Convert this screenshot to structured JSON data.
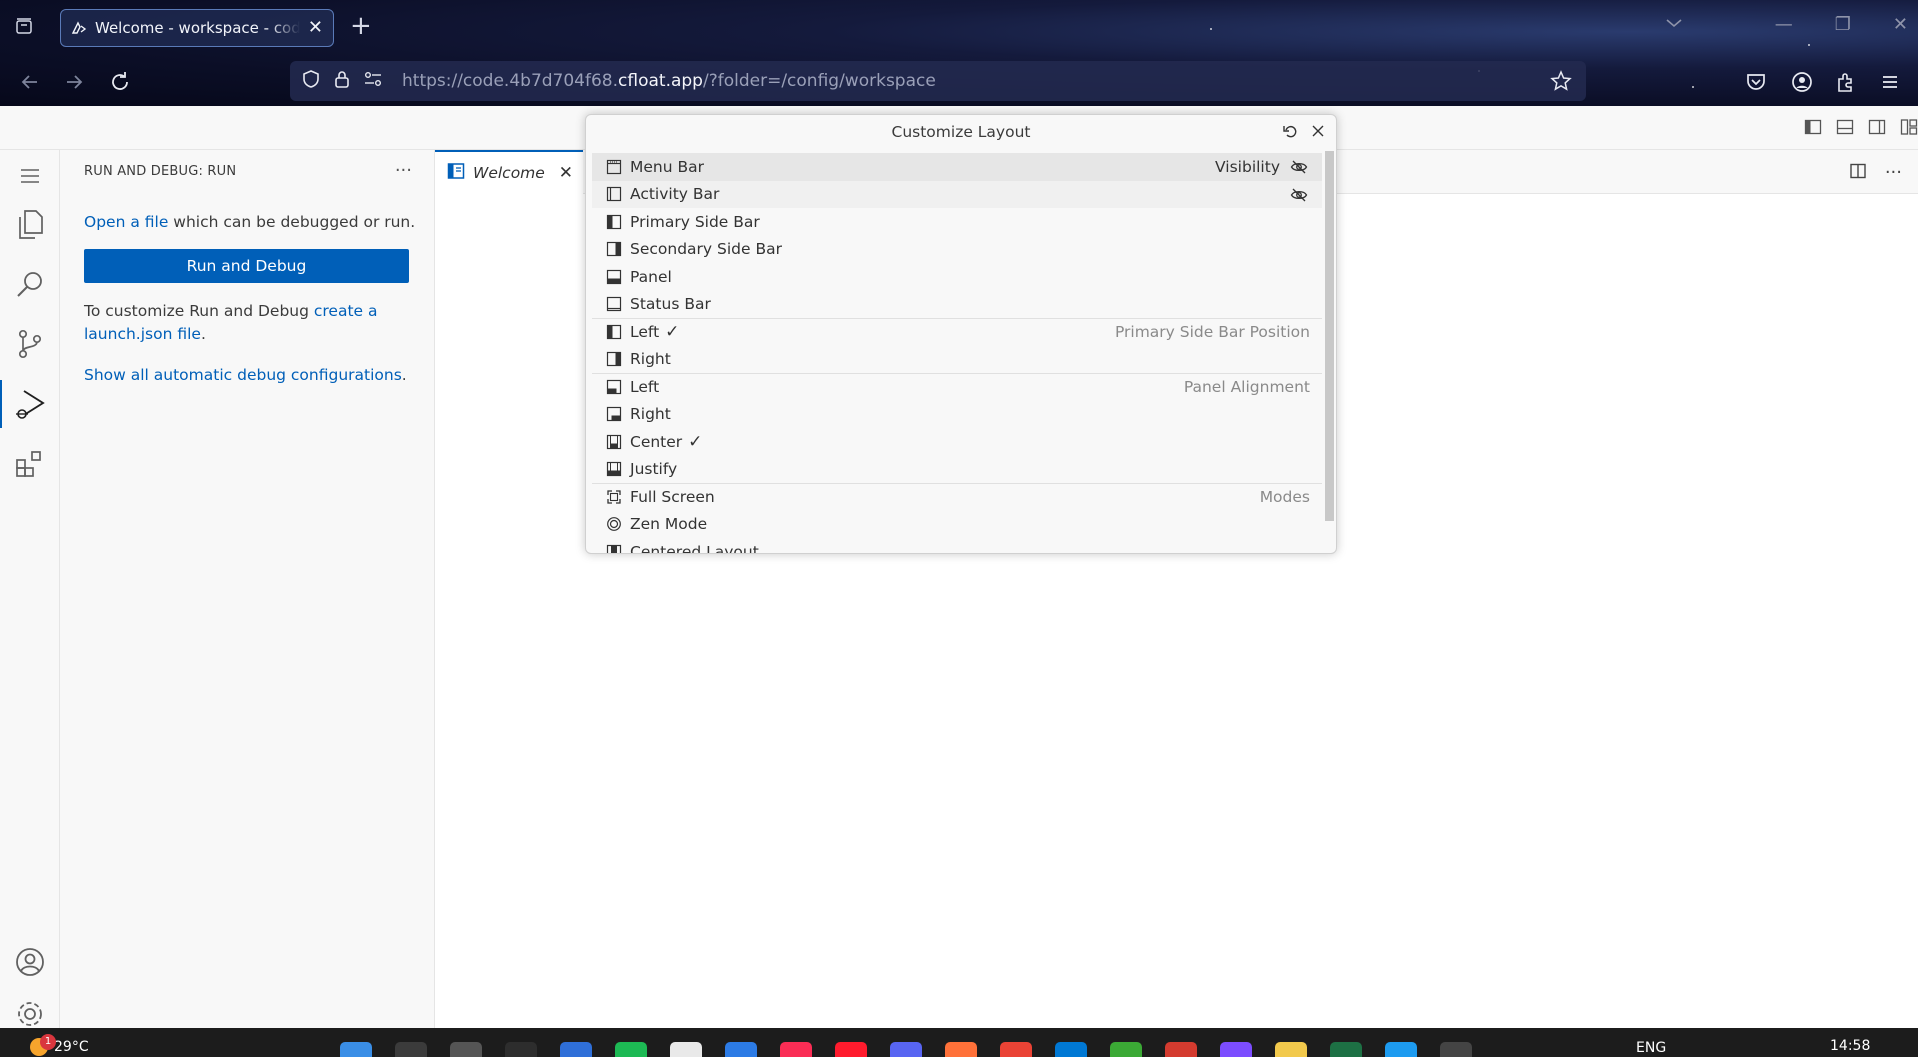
{
  "browser": {
    "tab_title": "Welcome - workspace - code-server",
    "url_prefix": "https://code.4b7d704f68.",
    "url_host": "cfloat.app",
    "url_suffix": "/?folder=/config/workspace"
  },
  "sidebar": {
    "header": "RUN AND DEBUG: RUN",
    "open_link": "Open a file",
    "open_rest": " which can be debugged or run.",
    "run_button": "Run and Debug",
    "customize_text": "To customize Run and Debug ",
    "customize_link": "create a launch.json file",
    "customize_end": ".",
    "show_all_link": "Show all automatic debug configurations",
    "show_all_end": "."
  },
  "editor": {
    "tab_label": "Welcome"
  },
  "quick_pick": {
    "title": "Customize Layout",
    "rows": [
      {
        "label": "Menu Bar",
        "icon": "menu-bar-icon",
        "group": "Visibility",
        "eye": true,
        "check": "",
        "sep": false,
        "state": "focused"
      },
      {
        "label": "Activity Bar",
        "icon": "activity-bar-icon",
        "group": "",
        "eye": true,
        "check": "",
        "sep": false,
        "state": "hovered"
      },
      {
        "label": "Primary Side Bar",
        "icon": "primary-sidebar-icon",
        "group": "",
        "eye": false,
        "check": "",
        "sep": false,
        "state": ""
      },
      {
        "label": "Secondary Side Bar",
        "icon": "secondary-sidebar-icon",
        "group": "",
        "eye": false,
        "check": "",
        "sep": false,
        "state": ""
      },
      {
        "label": "Panel",
        "icon": "panel-icon",
        "group": "",
        "eye": false,
        "check": "",
        "sep": false,
        "state": ""
      },
      {
        "label": "Status Bar",
        "icon": "status-bar-icon",
        "group": "",
        "eye": false,
        "check": "",
        "sep": false,
        "state": ""
      },
      {
        "label": "Left",
        "icon": "sidebar-left-icon",
        "group": "Primary Side Bar Position",
        "eye": false,
        "check": "✓",
        "sep": true,
        "state": ""
      },
      {
        "label": "Right",
        "icon": "sidebar-right-icon",
        "group": "",
        "eye": false,
        "check": "",
        "sep": false,
        "state": ""
      },
      {
        "label": "Left",
        "icon": "panel-align-left-icon",
        "group": "Panel Alignment",
        "eye": false,
        "check": "",
        "sep": true,
        "state": ""
      },
      {
        "label": "Right",
        "icon": "panel-align-right-icon",
        "group": "",
        "eye": false,
        "check": "",
        "sep": false,
        "state": ""
      },
      {
        "label": "Center",
        "icon": "panel-align-center-icon",
        "group": "",
        "eye": false,
        "check": "✓",
        "sep": false,
        "state": ""
      },
      {
        "label": "Justify",
        "icon": "panel-align-justify-icon",
        "group": "",
        "eye": false,
        "check": "",
        "sep": false,
        "state": ""
      },
      {
        "label": "Full Screen",
        "icon": "full-screen-icon",
        "group": "Modes",
        "eye": false,
        "check": "",
        "sep": true,
        "state": ""
      },
      {
        "label": "Zen Mode",
        "icon": "zen-mode-icon",
        "group": "",
        "eye": false,
        "check": "",
        "sep": false,
        "state": ""
      },
      {
        "label": "Centered Layout",
        "icon": "centered-layout-icon",
        "group": "",
        "eye": false,
        "check": "",
        "sep": false,
        "state": ""
      }
    ]
  },
  "taskbar": {
    "temperature": "29°C",
    "weather_badge": "1",
    "language": "ENG",
    "time": "14:58"
  },
  "colors": {
    "accent": "#005fb8",
    "browser_bg": "#0b0e26"
  }
}
